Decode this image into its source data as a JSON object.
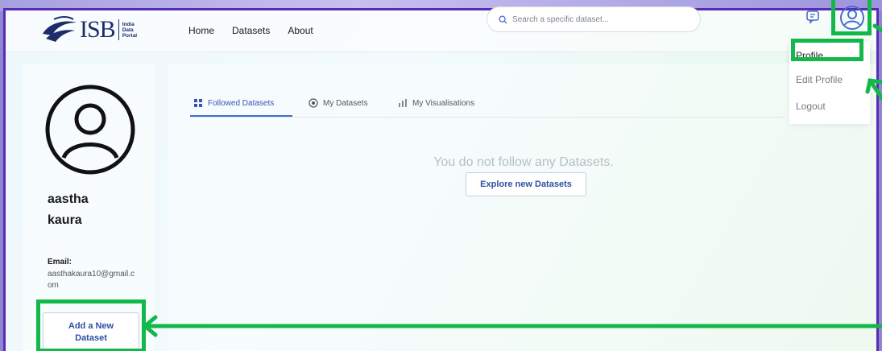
{
  "header": {
    "logo": {
      "mark_text": "ISB",
      "sub_text": [
        "India",
        "Data",
        "Portal"
      ]
    },
    "nav": [
      {
        "label": "Home"
      },
      {
        "label": "Datasets"
      },
      {
        "label": "About"
      }
    ],
    "search": {
      "placeholder": "Search a specific dataset..."
    }
  },
  "profile_menu": {
    "items": [
      {
        "label": "Profile"
      },
      {
        "label": "Edit Profile"
      },
      {
        "label": "Logout"
      }
    ]
  },
  "user": {
    "first_name": "aastha",
    "last_name": "kaura",
    "email_label": "Email:",
    "email": "aasthakaura10@gmail.com",
    "add_button_label": "Add a New Dataset"
  },
  "tabs": [
    {
      "label": "Followed Datasets",
      "icon": "grid-icon",
      "active": true
    },
    {
      "label": "My Datasets",
      "icon": "eye-icon",
      "active": false
    },
    {
      "label": "My Visualisations",
      "icon": "bar-chart-icon",
      "active": false
    }
  ],
  "content": {
    "empty_message": "You do not follow any Datasets.",
    "explore_button_label": "Explore new Datasets"
  },
  "annotation": {
    "highlight_color": "#13b84a",
    "frame_color": "#5b2bb7"
  }
}
